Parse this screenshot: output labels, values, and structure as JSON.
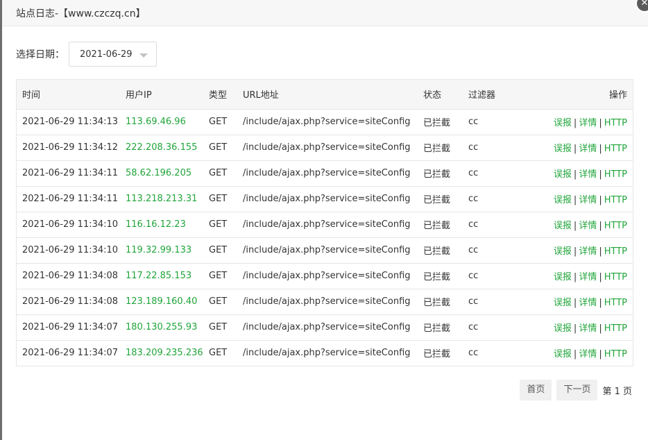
{
  "dialog": {
    "title": "站点日志-【www.czczq.cn】"
  },
  "filter": {
    "label": "选择日期：",
    "date_value": "2021-06-29"
  },
  "table": {
    "headers": {
      "time": "时间",
      "ip": "用户IP",
      "type": "类型",
      "url": "URL地址",
      "status": "状态",
      "filter": "过滤器",
      "ops": "操作"
    },
    "ops_labels": {
      "report": "误报",
      "detail": "详情",
      "http": "HTTP",
      "sep": "|"
    },
    "rows": [
      {
        "time": "2021-06-29 11:34:13",
        "ip": "113.69.46.96",
        "type": "GET",
        "url": "/include/ajax.php?service=siteConfig",
        "status": "已拦截",
        "filter": "cc"
      },
      {
        "time": "2021-06-29 11:34:12",
        "ip": "222.208.36.155",
        "type": "GET",
        "url": "/include/ajax.php?service=siteConfig",
        "status": "已拦截",
        "filter": "cc"
      },
      {
        "time": "2021-06-29 11:34:11",
        "ip": "58.62.196.205",
        "type": "GET",
        "url": "/include/ajax.php?service=siteConfig",
        "status": "已拦截",
        "filter": "cc"
      },
      {
        "time": "2021-06-29 11:34:11",
        "ip": "113.218.213.31",
        "type": "GET",
        "url": "/include/ajax.php?service=siteConfig",
        "status": "已拦截",
        "filter": "cc"
      },
      {
        "time": "2021-06-29 11:34:10",
        "ip": "116.16.12.23",
        "type": "GET",
        "url": "/include/ajax.php?service=siteConfig",
        "status": "已拦截",
        "filter": "cc"
      },
      {
        "time": "2021-06-29 11:34:10",
        "ip": "119.32.99.133",
        "type": "GET",
        "url": "/include/ajax.php?service=siteConfig",
        "status": "已拦截",
        "filter": "cc"
      },
      {
        "time": "2021-06-29 11:34:08",
        "ip": "117.22.85.153",
        "type": "GET",
        "url": "/include/ajax.php?service=siteConfig",
        "status": "已拦截",
        "filter": "cc"
      },
      {
        "time": "2021-06-29 11:34:08",
        "ip": "123.189.160.40",
        "type": "GET",
        "url": "/include/ajax.php?service=siteConfig",
        "status": "已拦截",
        "filter": "cc"
      },
      {
        "time": "2021-06-29 11:34:07",
        "ip": "180.130.255.93",
        "type": "GET",
        "url": "/include/ajax.php?service=siteConfig",
        "status": "已拦截",
        "filter": "cc"
      },
      {
        "time": "2021-06-29 11:34:07",
        "ip": "183.209.235.236",
        "type": "GET",
        "url": "/include/ajax.php?service=siteConfig",
        "status": "已拦截",
        "filter": "cc"
      }
    ]
  },
  "pager": {
    "first": "首页",
    "next": "下一页",
    "current": "第 1 页"
  },
  "colors": {
    "accent_green": "#20a53a",
    "header_bg": "#f7f7f7"
  },
  "icons": {
    "close": "close-icon",
    "caret": "chevron-down-icon"
  }
}
